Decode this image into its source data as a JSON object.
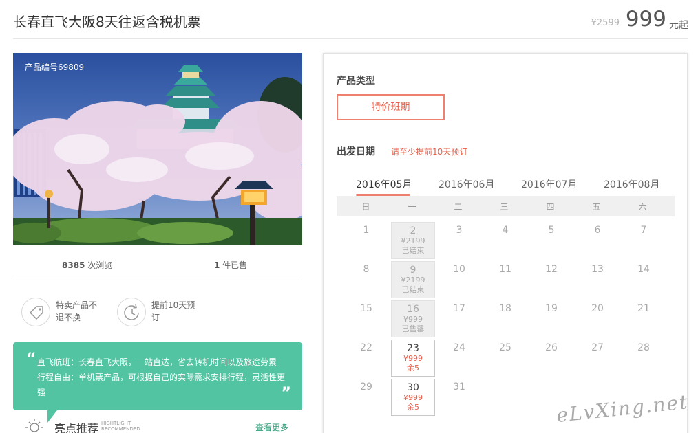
{
  "header": {
    "title": "长春直飞大阪8天往返含税机票",
    "old_price": "¥2599",
    "price": "999",
    "price_suffix": "元起"
  },
  "product": {
    "number_label": "产品编号69809",
    "views": "8385",
    "views_label": " 次浏览",
    "sold": "1",
    "sold_label": " 件已售",
    "features": [
      "特卖产品不退不换",
      "提前10天预订"
    ]
  },
  "description": {
    "lines": [
      "直飞航班：长春直飞大阪，一站直达，省去转机时间以及旅途劳累",
      "行程自由：单机票产品，可根据自己的实际需求安排行程，灵活性更强"
    ]
  },
  "highlights": {
    "title": "亮点推荐",
    "en_line1": "HIGHTLIGHT",
    "en_line2": "RECOMMENDED",
    "more": "查看更多"
  },
  "booking": {
    "type_title": "产品类型",
    "type_option": "特价班期",
    "date_title": "出发日期",
    "date_note": "请至少提前10天预订",
    "months": [
      "2016年05月",
      "2016年06月",
      "2016年07月",
      "2016年08月"
    ],
    "active_month": "2016年05月",
    "weekdays": [
      "日",
      "一",
      "二",
      "三",
      "四",
      "五",
      "六"
    ],
    "days": [
      {
        "d": "1"
      },
      {
        "d": "2",
        "p": "¥2199",
        "s": "已结束",
        "state": "ended"
      },
      {
        "d": "3"
      },
      {
        "d": "4"
      },
      {
        "d": "5"
      },
      {
        "d": "6"
      },
      {
        "d": "7"
      },
      {
        "d": "8"
      },
      {
        "d": "9",
        "p": "¥2199",
        "s": "已结束",
        "state": "ended"
      },
      {
        "d": "10"
      },
      {
        "d": "11"
      },
      {
        "d": "12"
      },
      {
        "d": "13"
      },
      {
        "d": "14"
      },
      {
        "d": "15"
      },
      {
        "d": "16",
        "p": "¥999",
        "s": "已售罄",
        "state": "ended"
      },
      {
        "d": "17"
      },
      {
        "d": "18"
      },
      {
        "d": "19"
      },
      {
        "d": "20"
      },
      {
        "d": "21"
      },
      {
        "d": "22"
      },
      {
        "d": "23",
        "p": "¥999",
        "s": "余5",
        "state": "avail"
      },
      {
        "d": "24"
      },
      {
        "d": "25"
      },
      {
        "d": "26"
      },
      {
        "d": "27"
      },
      {
        "d": "28"
      },
      {
        "d": "29"
      },
      {
        "d": "30",
        "p": "¥999",
        "s": "余5",
        "state": "avail"
      },
      {
        "d": "31"
      }
    ]
  },
  "watermark": "eLvXing.net",
  "colors": {
    "accent": "#e8604c",
    "teal": "#52c4a1",
    "link_green": "#2e9d77"
  }
}
